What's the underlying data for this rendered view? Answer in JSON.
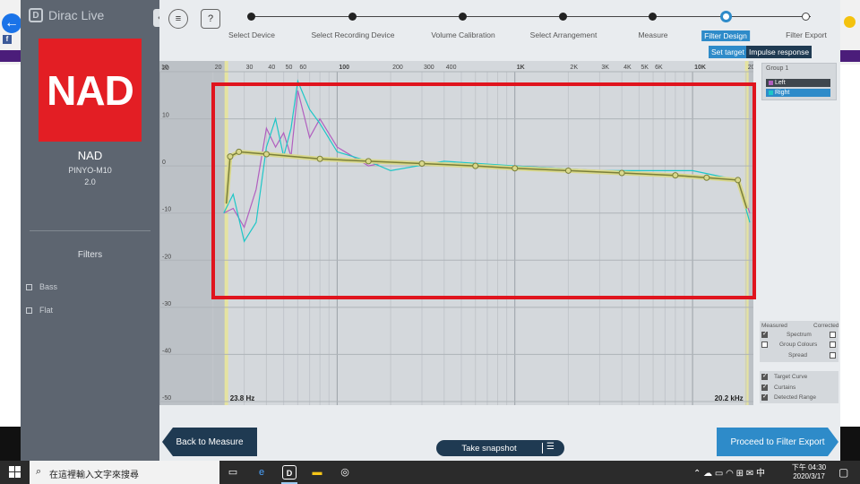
{
  "app": {
    "brand": "Dirac Live",
    "brand_logo_glyph": "D"
  },
  "device": {
    "logo_text": "NAD",
    "name": "NAD",
    "model": "PINYO-M10",
    "version": "2.0"
  },
  "filters": {
    "title": "Filters",
    "items": [
      "Bass",
      "Flat"
    ]
  },
  "steps": [
    {
      "label": "Select Device",
      "state": "done"
    },
    {
      "label": "Select Recording Device",
      "state": "done"
    },
    {
      "label": "Volume Calibration",
      "state": "done"
    },
    {
      "label": "Select Arrangement",
      "state": "done"
    },
    {
      "label": "Measure",
      "state": "done"
    },
    {
      "label": "Filter Design",
      "state": "active"
    },
    {
      "label": "Filter Export",
      "state": "open"
    }
  ],
  "toolbar": {
    "menu_icon": "≡",
    "help_icon": "?",
    "set_target": "Set target",
    "impulse_response": "Impulse response"
  },
  "graph": {
    "y_ticks": [
      "20",
      "10",
      "0",
      "-10",
      "-20",
      "-30",
      "-40",
      "-50"
    ],
    "x_tick_labels": [
      "10",
      "20",
      "30",
      "40",
      "50",
      "60",
      "100",
      "200",
      "300",
      "400",
      "1K",
      "2K",
      "3K",
      "4K",
      "5K",
      "6K",
      "10K",
      "20K"
    ],
    "low_freq_label": "23.8 Hz",
    "high_freq_label": "20.2 kHz",
    "colors": {
      "left": "#b15fbf",
      "right": "#1dc7c7",
      "target": "#7a7f3a",
      "target_fill": "#d9d88c"
    }
  },
  "chart_data": {
    "type": "line",
    "title": "",
    "xlabel": "",
    "ylabel": "",
    "x_scale": "log",
    "xlim": [
      10,
      22000
    ],
    "ylim": [
      -50,
      20
    ],
    "series": [
      {
        "name": "Left",
        "x": [
          23,
          26,
          30,
          35,
          40,
          45,
          50,
          55,
          60,
          70,
          80,
          100,
          150,
          200,
          400,
          1000,
          3000,
          10000,
          18000,
          21000
        ],
        "y": [
          -10,
          -9,
          -13,
          -5,
          8,
          4,
          7,
          2,
          16,
          6,
          10,
          4,
          0,
          1,
          0,
          0,
          -1,
          -2,
          -3,
          -10
        ]
      },
      {
        "name": "Right",
        "x": [
          23,
          26,
          30,
          35,
          40,
          45,
          50,
          55,
          60,
          70,
          80,
          100,
          150,
          200,
          400,
          1000,
          3000,
          10000,
          18000,
          21000
        ],
        "y": [
          -10,
          -6,
          -16,
          -12,
          4,
          10,
          2,
          8,
          18,
          12,
          9,
          3,
          1,
          -1,
          1,
          0,
          -1,
          -1,
          -3,
          -12
        ]
      },
      {
        "name": "Target Curve",
        "x": [
          23.8,
          25,
          28,
          40,
          80,
          150,
          300,
          600,
          1000,
          2000,
          4000,
          8000,
          12000,
          18000,
          20200
        ],
        "y": [
          -8,
          2,
          3,
          2.5,
          1.5,
          1,
          0.5,
          0,
          -0.5,
          -1,
          -1.5,
          -2,
          -2.5,
          -3,
          -9
        ]
      }
    ]
  },
  "group": {
    "title": "Group 1",
    "left": "Left",
    "right": "Right"
  },
  "options": {
    "header_measured": "Measured",
    "header_corrected": "Corrected",
    "spectrum": "Spectrum",
    "group_colours": "Group Colours",
    "spread": "Spread",
    "target_curve": "Target Curve",
    "curtains": "Curtains",
    "detected_range": "Detected Range"
  },
  "bottom": {
    "back": "Back to Measure",
    "snapshot": "Take snapshot",
    "proceed": "Proceed to Filter Export"
  },
  "taskbar": {
    "search_placeholder": "在這裡輸入文字來搜尋",
    "time": "下午 04:30",
    "date": "2020/3/17"
  }
}
